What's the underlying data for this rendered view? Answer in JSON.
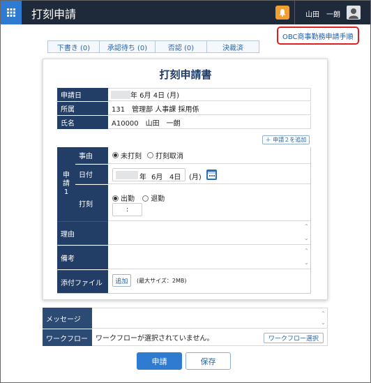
{
  "header": {
    "title": "打刻申請",
    "user_name": "山田　一朗"
  },
  "obc_link": "OBC商事勤務申請手順",
  "status_tabs": [
    {
      "label": "下書き (0)"
    },
    {
      "label": "承認待ち (0)"
    },
    {
      "label": "否認 (0)"
    },
    {
      "label": "決裁済"
    }
  ],
  "form": {
    "title": "打刻申請書",
    "apply_date_label": "申請日",
    "apply_date_value": "年 6月 4日 (月)",
    "dept_label": "所属",
    "dept_value": "131　管理部 人事課 採用係",
    "name_label": "氏名",
    "name_value": "A10000　山田　一朗",
    "add_button": "＋ 申請２を追加",
    "section_label": "申請1",
    "reason_label": "事由",
    "reason_options": [
      "未打刻",
      "打刻取消"
    ],
    "date_label": "日付",
    "date_year_suffix": "年",
    "date_month": "6月",
    "date_day": "4日",
    "date_weekday": "(月)",
    "punch_label": "打刻",
    "punch_options": [
      "出勤",
      "退勤"
    ],
    "time_sep": ":",
    "memo_reason_label": "理由",
    "memo_label": "備考",
    "attach_label": "添付ファイル",
    "attach_button": "追加",
    "attach_note": "(最大サイズ：2MB)"
  },
  "message_label": "メッセージ",
  "workflow_label": "ワークフロー",
  "workflow_value": "ワークフローが選択されていません。",
  "workflow_button": "ワークフロー選択",
  "apply_button": "申請",
  "save_button": "保存",
  "colors": {
    "header_bg": "#1e2a3a",
    "accent": "#2e7bd1",
    "label_bg": "#223e66",
    "highlight": "#e02020"
  }
}
